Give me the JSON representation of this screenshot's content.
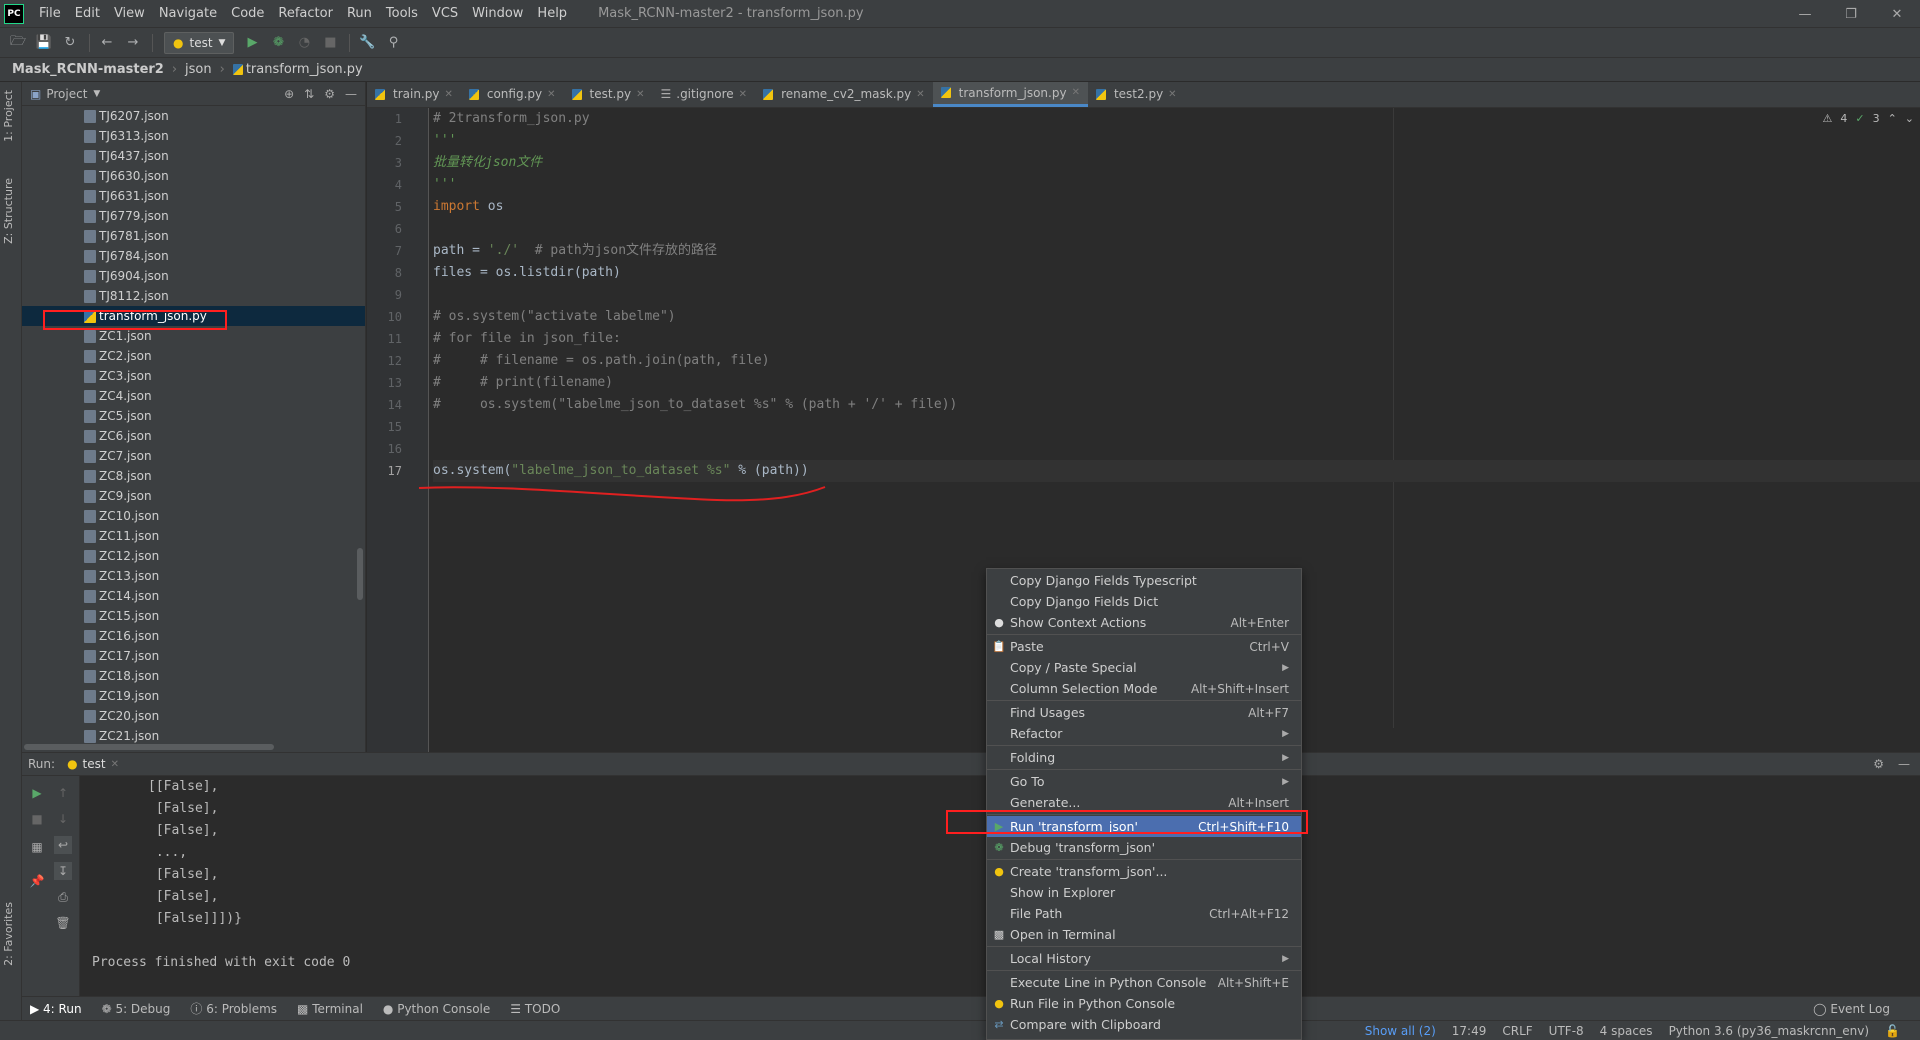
{
  "app": {
    "logo_text": "PC",
    "window_title": "Mask_RCNN-master2 - transform_json.py",
    "menu": [
      "File",
      "Edit",
      "View",
      "Navigate",
      "Code",
      "Refactor",
      "Run",
      "Tools",
      "VCS",
      "Window",
      "Help"
    ]
  },
  "toolbar": {
    "run_config": "test"
  },
  "breadcrumb": [
    "Mask_RCNN-master2",
    "json",
    "transform_json.py"
  ],
  "left_stripe": {
    "project_tab": "1: Project",
    "structure_tab": "Z: Structure",
    "favorites_tab": "2: Favorites"
  },
  "project_panel": {
    "title": "Project",
    "files": [
      "TJ6207.json",
      "TJ6313.json",
      "TJ6437.json",
      "TJ6630.json",
      "TJ6631.json",
      "TJ6779.json",
      "TJ6781.json",
      "TJ6784.json",
      "TJ6904.json",
      "TJ8112.json",
      "transform_json.py",
      "ZC1.json",
      "ZC2.json",
      "ZC3.json",
      "ZC4.json",
      "ZC5.json",
      "ZC6.json",
      "ZC7.json",
      "ZC8.json",
      "ZC9.json",
      "ZC10.json",
      "ZC11.json",
      "ZC12.json",
      "ZC13.json",
      "ZC14.json",
      "ZC15.json",
      "ZC16.json",
      "ZC17.json",
      "ZC18.json",
      "ZC19.json",
      "ZC20.json",
      "ZC21.json"
    ],
    "selected": "transform_json.py"
  },
  "editor": {
    "tabs": [
      "train.py",
      "config.py",
      "test.py",
      ".gitignore",
      "rename_cv2_mask.py",
      "transform_json.py",
      "test2.py"
    ],
    "active_tab": "transform_json.py",
    "line_numbers": [
      "1",
      "2",
      "3",
      "4",
      "5",
      "6",
      "7",
      "8",
      "9",
      "10",
      "11",
      "12",
      "13",
      "14",
      "15",
      "16",
      "17"
    ],
    "current_line": "17",
    "inspection": {
      "warnings": "4",
      "ok": "3"
    },
    "code": {
      "l1": "# 2transform_json.py",
      "l2": "'''",
      "l3": "批量转化json文件",
      "l4": "'''",
      "l5_kw": "import",
      "l5_id": " os",
      "l7_a": "path = ",
      "l7_str": "'./'",
      "l7_cm": "  # path为json文件存放的路径",
      "l8": "files = os.listdir(path)",
      "l10": "# os.system(\"activate labelme\")",
      "l11": "# for file in json_file:",
      "l12": "#     # filename = os.path.join(path, file)",
      "l13": "#     # print(filename)",
      "l14": "#     os.system(\"labelme_json_to_dataset %s\" % (path + '/' + file))",
      "l17_a": "os.system(",
      "l17_str": "\"labelme_json_to_dataset %s\"",
      "l17_b": " % (path))"
    }
  },
  "run_panel": {
    "label": "Run:",
    "tab": "test",
    "output": [
      "[[False],",
      " [False],",
      " [False],",
      " ...,",
      " [False],",
      " [False],",
      " [False]]])}",
      "",
      "Process finished with exit code 0"
    ]
  },
  "context_menu": {
    "items": [
      {
        "label": "Copy Django Fields Typescript",
        "shortcut": ""
      },
      {
        "label": "Copy Django Fields Dict",
        "shortcut": ""
      },
      {
        "label": "Show Context Actions",
        "shortcut": "Alt+Enter"
      },
      {
        "label": "Paste",
        "shortcut": "Ctrl+V"
      },
      {
        "label": "Copy / Paste Special",
        "shortcut": ""
      },
      {
        "label": "Column Selection Mode",
        "shortcut": "Alt+Shift+Insert"
      },
      {
        "label": "Find Usages",
        "shortcut": "Alt+F7"
      },
      {
        "label": "Refactor",
        "shortcut": ""
      },
      {
        "label": "Folding",
        "shortcut": ""
      },
      {
        "label": "Go To",
        "shortcut": ""
      },
      {
        "label": "Generate...",
        "shortcut": "Alt+Insert"
      },
      {
        "label": "Run 'transform_json'",
        "shortcut": "Ctrl+Shift+F10"
      },
      {
        "label": "Debug 'transform_json'",
        "shortcut": ""
      },
      {
        "label": "Create 'transform_json'...",
        "shortcut": ""
      },
      {
        "label": "Show in Explorer",
        "shortcut": ""
      },
      {
        "label": "File Path",
        "shortcut": "Ctrl+Alt+F12"
      },
      {
        "label": "Open in Terminal",
        "shortcut": ""
      },
      {
        "label": "Local History",
        "shortcut": ""
      },
      {
        "label": "Execute Line in Python Console",
        "shortcut": "Alt+Shift+E"
      },
      {
        "label": "Run File in Python Console",
        "shortcut": ""
      },
      {
        "label": "Compare with Clipboard",
        "shortcut": ""
      }
    ]
  },
  "bottom_tools": [
    "4: Run",
    "5: Debug",
    "6: Problems",
    "Terminal",
    "Python Console",
    "TODO"
  ],
  "event_log": "Event Log",
  "status": {
    "show_all": "Show all (2)",
    "position": "17:49",
    "line_sep": "CRLF",
    "encoding": "UTF-8",
    "indent": "4 spaces",
    "interpreter": "Python 3.6 (py36_maskrcnn_env)"
  },
  "colors": {
    "highlight_box": "#ff1f1f",
    "menu_selection": "#4b6eaf",
    "active_tab_underline": "#4a88c7"
  }
}
